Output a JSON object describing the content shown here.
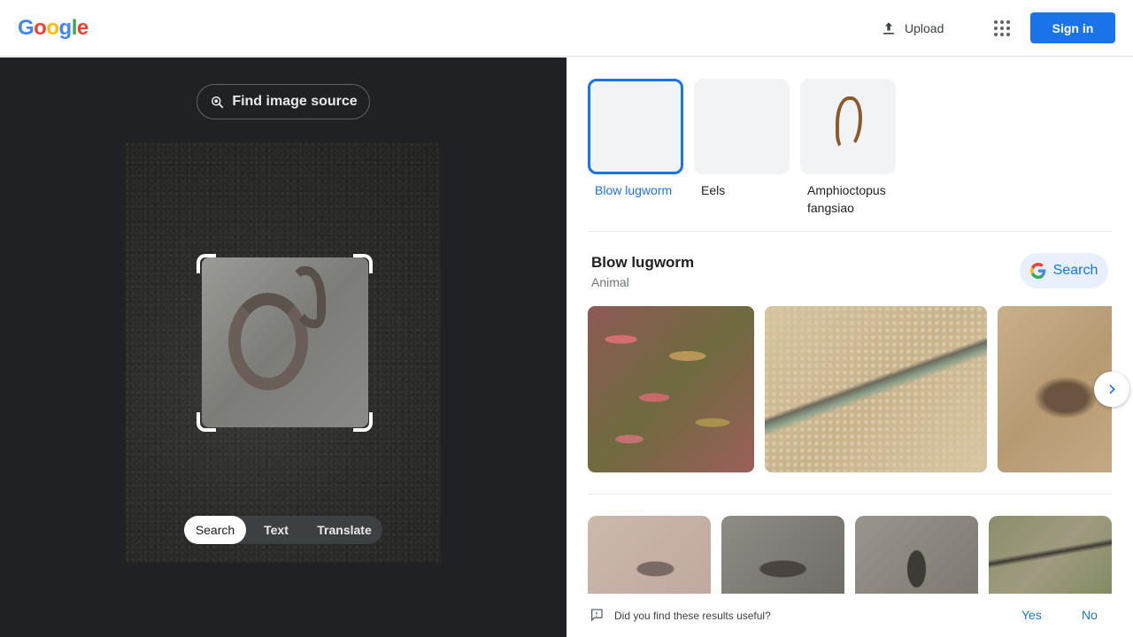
{
  "header": {
    "logo_letters": [
      {
        "ch": "G",
        "color": "#4285F4"
      },
      {
        "ch": "o",
        "color": "#EA4335"
      },
      {
        "ch": "o",
        "color": "#FBBC05"
      },
      {
        "ch": "g",
        "color": "#4285F4"
      },
      {
        "ch": "l",
        "color": "#34A853"
      },
      {
        "ch": "e",
        "color": "#EA4335"
      }
    ],
    "upload_label": "Upload",
    "signin_label": "Sign in"
  },
  "left": {
    "find_source_label": "Find image source",
    "mode_tabs": [
      "Search",
      "Text",
      "Translate"
    ],
    "active_mode": "Search"
  },
  "right": {
    "chips": [
      {
        "label": "Blow lugworm",
        "active": true
      },
      {
        "label": "Eels",
        "active": false
      },
      {
        "label": "Amphioctopus fangsiao",
        "active": false
      }
    ],
    "entity": {
      "title": "Blow lugworm",
      "subtitle": "Animal",
      "search_label": "Search"
    },
    "feedback": {
      "question": "Did you find these results useful?",
      "yes": "Yes",
      "no": "No"
    }
  },
  "colors": {
    "accent": "#1a73e8",
    "dark_panel": "#202124",
    "chip_active_border": "#1a73e8"
  }
}
